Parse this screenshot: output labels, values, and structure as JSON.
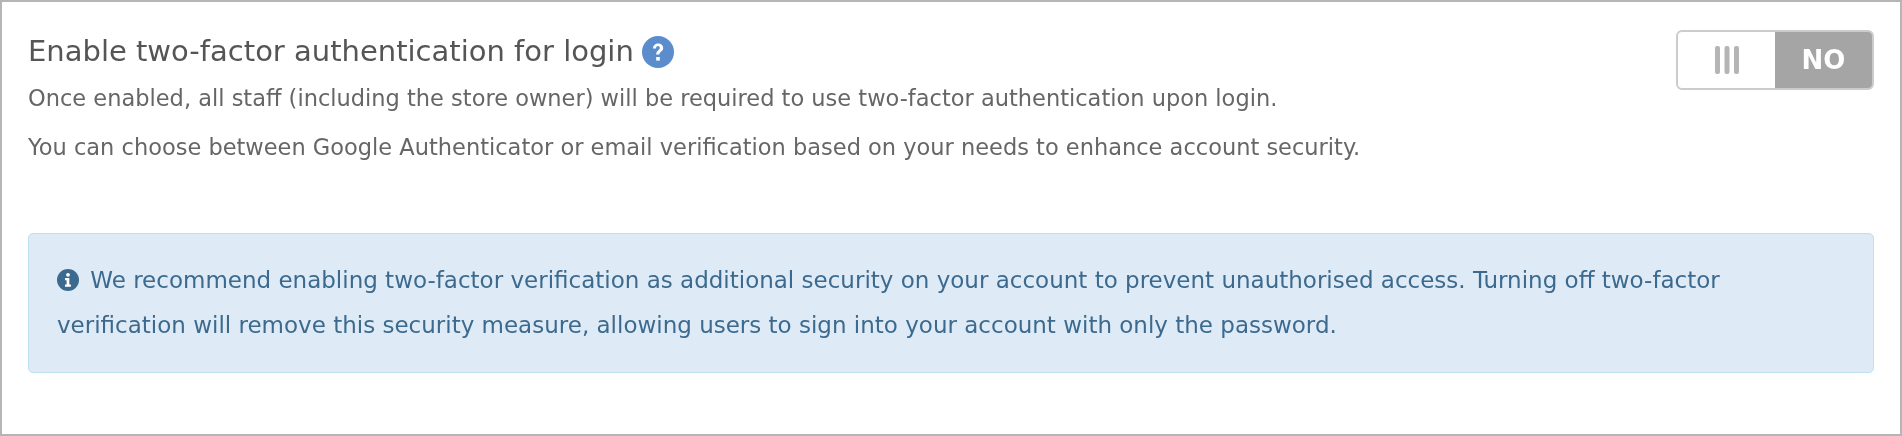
{
  "setting": {
    "title": "Enable two-factor authentication for login",
    "descriptions": [
      "Once enabled, all staff (including the store owner) will be required to use two-factor authentication upon login.",
      "You can choose between Google Authenticator or email verification based on your needs to enhance account security."
    ],
    "toggle": {
      "on": false,
      "label": "NO"
    }
  },
  "alert": {
    "text": "We recommend enabling two-factor verification as additional security on your account to prevent unauthorised access. Turning off two-factor verification will remove this security measure, allowing users to sign into your account with only the password."
  }
}
